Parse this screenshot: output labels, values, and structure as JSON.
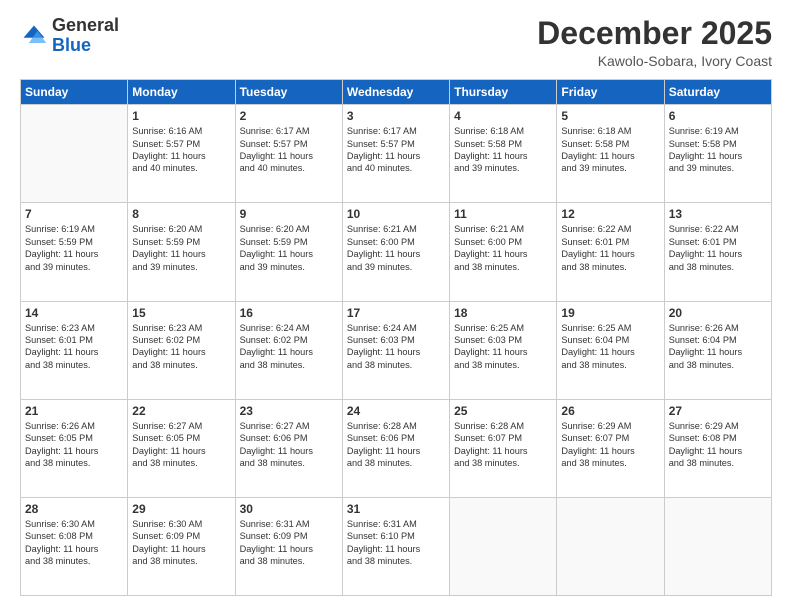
{
  "header": {
    "logo_general": "General",
    "logo_blue": "Blue",
    "month_title": "December 2025",
    "location": "Kawolo-Sobara, Ivory Coast"
  },
  "weekdays": [
    "Sunday",
    "Monday",
    "Tuesday",
    "Wednesday",
    "Thursday",
    "Friday",
    "Saturday"
  ],
  "weeks": [
    [
      {
        "day": "",
        "content": ""
      },
      {
        "day": "1",
        "content": "Sunrise: 6:16 AM\nSunset: 5:57 PM\nDaylight: 11 hours\nand 40 minutes."
      },
      {
        "day": "2",
        "content": "Sunrise: 6:17 AM\nSunset: 5:57 PM\nDaylight: 11 hours\nand 40 minutes."
      },
      {
        "day": "3",
        "content": "Sunrise: 6:17 AM\nSunset: 5:57 PM\nDaylight: 11 hours\nand 40 minutes."
      },
      {
        "day": "4",
        "content": "Sunrise: 6:18 AM\nSunset: 5:58 PM\nDaylight: 11 hours\nand 39 minutes."
      },
      {
        "day": "5",
        "content": "Sunrise: 6:18 AM\nSunset: 5:58 PM\nDaylight: 11 hours\nand 39 minutes."
      },
      {
        "day": "6",
        "content": "Sunrise: 6:19 AM\nSunset: 5:58 PM\nDaylight: 11 hours\nand 39 minutes."
      }
    ],
    [
      {
        "day": "7",
        "content": "Sunrise: 6:19 AM\nSunset: 5:59 PM\nDaylight: 11 hours\nand 39 minutes."
      },
      {
        "day": "8",
        "content": "Sunrise: 6:20 AM\nSunset: 5:59 PM\nDaylight: 11 hours\nand 39 minutes."
      },
      {
        "day": "9",
        "content": "Sunrise: 6:20 AM\nSunset: 5:59 PM\nDaylight: 11 hours\nand 39 minutes."
      },
      {
        "day": "10",
        "content": "Sunrise: 6:21 AM\nSunset: 6:00 PM\nDaylight: 11 hours\nand 39 minutes."
      },
      {
        "day": "11",
        "content": "Sunrise: 6:21 AM\nSunset: 6:00 PM\nDaylight: 11 hours\nand 38 minutes."
      },
      {
        "day": "12",
        "content": "Sunrise: 6:22 AM\nSunset: 6:01 PM\nDaylight: 11 hours\nand 38 minutes."
      },
      {
        "day": "13",
        "content": "Sunrise: 6:22 AM\nSunset: 6:01 PM\nDaylight: 11 hours\nand 38 minutes."
      }
    ],
    [
      {
        "day": "14",
        "content": "Sunrise: 6:23 AM\nSunset: 6:01 PM\nDaylight: 11 hours\nand 38 minutes."
      },
      {
        "day": "15",
        "content": "Sunrise: 6:23 AM\nSunset: 6:02 PM\nDaylight: 11 hours\nand 38 minutes."
      },
      {
        "day": "16",
        "content": "Sunrise: 6:24 AM\nSunset: 6:02 PM\nDaylight: 11 hours\nand 38 minutes."
      },
      {
        "day": "17",
        "content": "Sunrise: 6:24 AM\nSunset: 6:03 PM\nDaylight: 11 hours\nand 38 minutes."
      },
      {
        "day": "18",
        "content": "Sunrise: 6:25 AM\nSunset: 6:03 PM\nDaylight: 11 hours\nand 38 minutes."
      },
      {
        "day": "19",
        "content": "Sunrise: 6:25 AM\nSunset: 6:04 PM\nDaylight: 11 hours\nand 38 minutes."
      },
      {
        "day": "20",
        "content": "Sunrise: 6:26 AM\nSunset: 6:04 PM\nDaylight: 11 hours\nand 38 minutes."
      }
    ],
    [
      {
        "day": "21",
        "content": "Sunrise: 6:26 AM\nSunset: 6:05 PM\nDaylight: 11 hours\nand 38 minutes."
      },
      {
        "day": "22",
        "content": "Sunrise: 6:27 AM\nSunset: 6:05 PM\nDaylight: 11 hours\nand 38 minutes."
      },
      {
        "day": "23",
        "content": "Sunrise: 6:27 AM\nSunset: 6:06 PM\nDaylight: 11 hours\nand 38 minutes."
      },
      {
        "day": "24",
        "content": "Sunrise: 6:28 AM\nSunset: 6:06 PM\nDaylight: 11 hours\nand 38 minutes."
      },
      {
        "day": "25",
        "content": "Sunrise: 6:28 AM\nSunset: 6:07 PM\nDaylight: 11 hours\nand 38 minutes."
      },
      {
        "day": "26",
        "content": "Sunrise: 6:29 AM\nSunset: 6:07 PM\nDaylight: 11 hours\nand 38 minutes."
      },
      {
        "day": "27",
        "content": "Sunrise: 6:29 AM\nSunset: 6:08 PM\nDaylight: 11 hours\nand 38 minutes."
      }
    ],
    [
      {
        "day": "28",
        "content": "Sunrise: 6:30 AM\nSunset: 6:08 PM\nDaylight: 11 hours\nand 38 minutes."
      },
      {
        "day": "29",
        "content": "Sunrise: 6:30 AM\nSunset: 6:09 PM\nDaylight: 11 hours\nand 38 minutes."
      },
      {
        "day": "30",
        "content": "Sunrise: 6:31 AM\nSunset: 6:09 PM\nDaylight: 11 hours\nand 38 minutes."
      },
      {
        "day": "31",
        "content": "Sunrise: 6:31 AM\nSunset: 6:10 PM\nDaylight: 11 hours\nand 38 minutes."
      },
      {
        "day": "",
        "content": ""
      },
      {
        "day": "",
        "content": ""
      },
      {
        "day": "",
        "content": ""
      }
    ]
  ]
}
